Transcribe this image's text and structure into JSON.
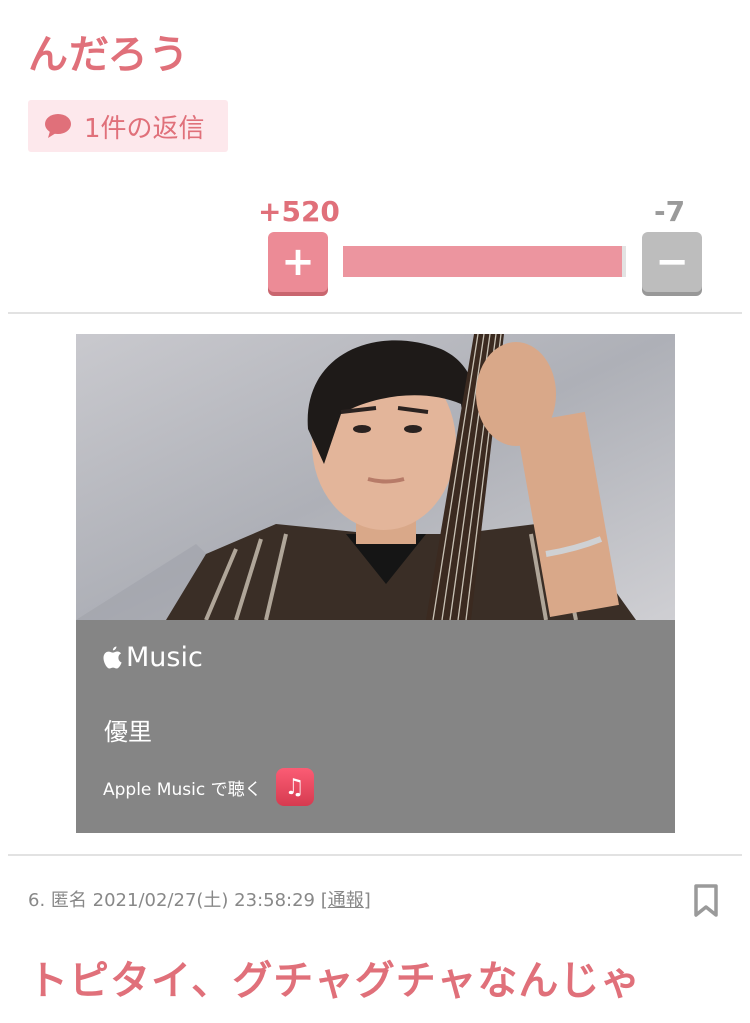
{
  "previous_comment": {
    "text_tail": "んだろう",
    "reply_button": {
      "label": "1件の返信",
      "icon": "speech-bubble-icon"
    }
  },
  "vote": {
    "plus_count": "+520",
    "minus_count": "-7",
    "plus_symbol": "+",
    "minus_symbol": "−",
    "plus_ratio": 0.987
  },
  "embed": {
    "brand": {
      "icon": "apple-logo-icon",
      "label": "Music"
    },
    "artist": "優里",
    "listen_label": "Apple Music で聴く",
    "app_icon": "music-note-icon",
    "app_icon_glyph": "♫"
  },
  "next_comment": {
    "number": "6.",
    "author": "匿名",
    "datetime": "2021/02/27(土) 23:58:29",
    "report_open": "[",
    "report_label": "通報",
    "report_close": "]",
    "text": "トピタイ、グチャグチャなんじゃ",
    "bookmark_icon": "bookmark-icon"
  },
  "colors": {
    "accent": "#e0707a",
    "plus_button": "#ec8b96",
    "minus_button": "#bdbdbd",
    "reply_bg": "#fde8ec",
    "embed_panel": "#858585"
  }
}
